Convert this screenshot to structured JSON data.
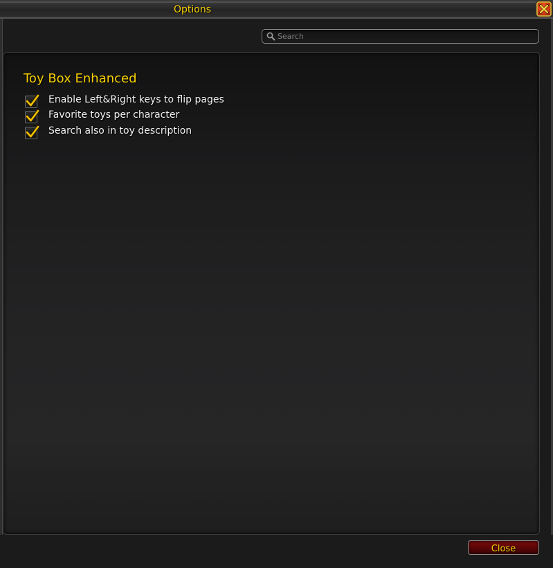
{
  "window": {
    "title": "Options",
    "close_icon": "close-x-icon"
  },
  "search": {
    "placeholder": "Search",
    "value": "",
    "icon": "search-icon"
  },
  "panel": {
    "title": "Toy Box Enhanced",
    "options": [
      {
        "label": "Enable Left&Right keys to flip pages",
        "checked": true
      },
      {
        "label": "Favorite toys per character",
        "checked": true
      },
      {
        "label": "Search also in toy description",
        "checked": true
      }
    ]
  },
  "footer": {
    "close_label": "Close"
  },
  "colors": {
    "accent_gold": "#f8d100",
    "close_button_red": "#6b0909",
    "checkmark_yellow": "#f2c200"
  }
}
